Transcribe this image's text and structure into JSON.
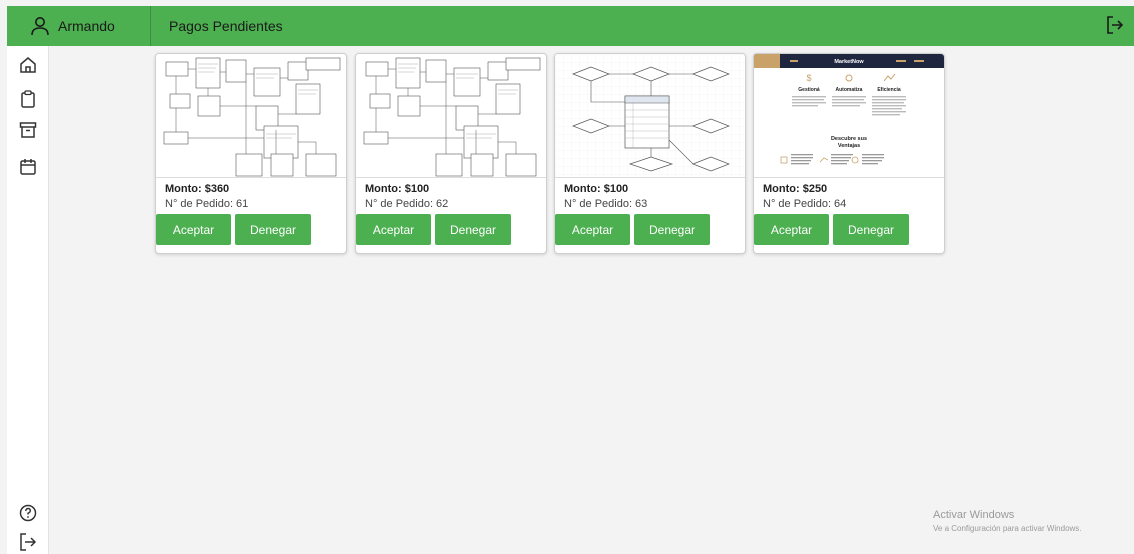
{
  "topbar": {
    "user_name": "Armando",
    "page_title": "Pagos Pendientes",
    "bg_color": "#4caf50",
    "user_icon": "user-icon",
    "logout_icon": "logout-icon"
  },
  "sidebar": {
    "items": [
      {
        "icon": "home-icon"
      },
      {
        "icon": "clipboard-icon"
      },
      {
        "icon": "archive-icon"
      },
      {
        "icon": "calendar-icon"
      }
    ],
    "bottom": [
      {
        "icon": "help-icon"
      },
      {
        "icon": "logout-icon"
      }
    ]
  },
  "cards": [
    {
      "amount": "Monto: $360",
      "order": "N° de Pedido: 61",
      "accept": "Aceptar",
      "deny": "Denegar",
      "thumb": "uml-diagram"
    },
    {
      "amount": "Monto: $100",
      "order": "N° de Pedido: 62",
      "accept": "Aceptar",
      "deny": "Denegar",
      "thumb": "uml-diagram"
    },
    {
      "amount": "Monto: $100",
      "order": "N° de Pedido: 63",
      "accept": "Aceptar",
      "deny": "Denegar",
      "thumb": "er-diagram"
    },
    {
      "amount": "Monto: $250",
      "order": "N° de Pedido: 64",
      "accept": "Aceptar",
      "deny": "Denegar",
      "thumb": "webpage",
      "page": {
        "brand": "MarketNow",
        "f1": "Gestioná",
        "f2": "Automatiza",
        "f3": "Eficiencia",
        "heading1": "Descubre sus",
        "heading2": "Ventajas"
      }
    }
  ],
  "watermark": {
    "title": "Activar Windows",
    "subtitle": "Ve a Configuración para activar Windows."
  }
}
